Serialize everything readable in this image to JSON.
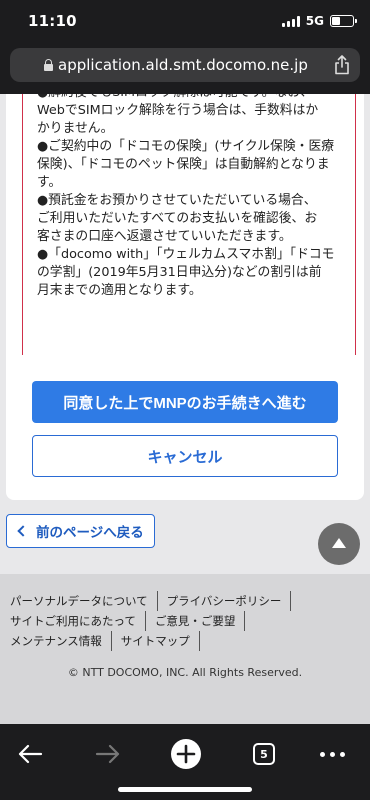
{
  "status_bar": {
    "time": "11:10",
    "network": "5G"
  },
  "browser": {
    "url": "application.ald.smt.docomo.ne.jp",
    "tab_count": "5"
  },
  "notice": {
    "lines": [
      "●解約後でもSIMロック解除は可能です。なお、",
      "WebでSIMロック解除を行う場合は、手数料はか",
      "かりません。",
      "●ご契約中の「ドコモの保険」(サイクル保険・医療",
      "保険)、「ドコモのペット保険」は自動解約となりま",
      "す。",
      "●預託金をお預かりさせていただいている場合、",
      "ご利用いただいたすべてのお支払いを確認後、お",
      "客さまの口座へ返還させていいただきます。",
      "●「docomo with」「ウェルカムスマホ割」「ドコモ",
      "の学割」(2019年5月31日申込分)などの割引は前",
      "月末までの適用となります。"
    ]
  },
  "actions": {
    "mnp_label": "同意した上でMNPのお手続きへ進む",
    "cancel_label": "キャンセル"
  },
  "back_label": "前のページへ戻る",
  "footer": {
    "rows": [
      [
        "パーソナルデータについて",
        "プライバシーポリシー"
      ],
      [
        "サイトご利用にあたって",
        "ご意見・ご要望"
      ],
      [
        "メンテナンス情報",
        "サイトマップ"
      ]
    ],
    "copyright": "© NTT DOCOMO, INC. All Rights Reserved."
  },
  "colors": {
    "primary": "#2f7be5",
    "notice_border": "#d0304a",
    "chrome": "#1c1c1e"
  },
  "icons": [
    "lock-icon",
    "share-icon",
    "back-arrow-icon",
    "forward-arrow-icon",
    "new-tab-icon",
    "tabs-icon",
    "more-icon",
    "scroll-top-icon"
  ]
}
